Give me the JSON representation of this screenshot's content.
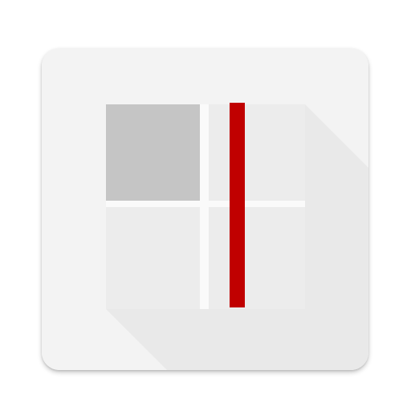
{
  "icon": {
    "name": "grid-layout-app-icon",
    "colors": {
      "background": "#f3f3f3",
      "long_shadow": "#e9e9e9",
      "tile_light": "#ececec",
      "tile_dark": "#c5c5c5",
      "gap": "#fafafa",
      "divider": "#c00000"
    }
  }
}
